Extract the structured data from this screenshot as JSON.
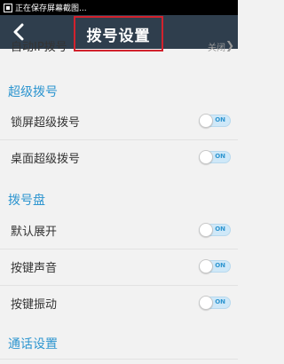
{
  "statusbar": {
    "notification_text": "正在保存屏幕截图..."
  },
  "header": {
    "title": "拨号设置",
    "back_icon": "chevron-left-icon"
  },
  "partial_row": {
    "label": "自动IP拨号",
    "value": "关闭"
  },
  "sections": [
    {
      "title": "超级拨号",
      "items": [
        {
          "label": "锁屏超级拨号",
          "toggle": "ON"
        },
        {
          "label": "桌面超级拨号",
          "toggle": "ON"
        }
      ]
    },
    {
      "title": "拨号盘",
      "items": [
        {
          "label": "默认展开",
          "toggle": "ON"
        },
        {
          "label": "按键声音",
          "toggle": "ON"
        },
        {
          "label": "按键振动",
          "toggle": "ON"
        }
      ]
    },
    {
      "title": "通话设置",
      "items": []
    }
  ],
  "colors": {
    "accent": "#2f96d0",
    "titlebar": "#2f3e4d",
    "highlight_border": "#d2222d"
  }
}
